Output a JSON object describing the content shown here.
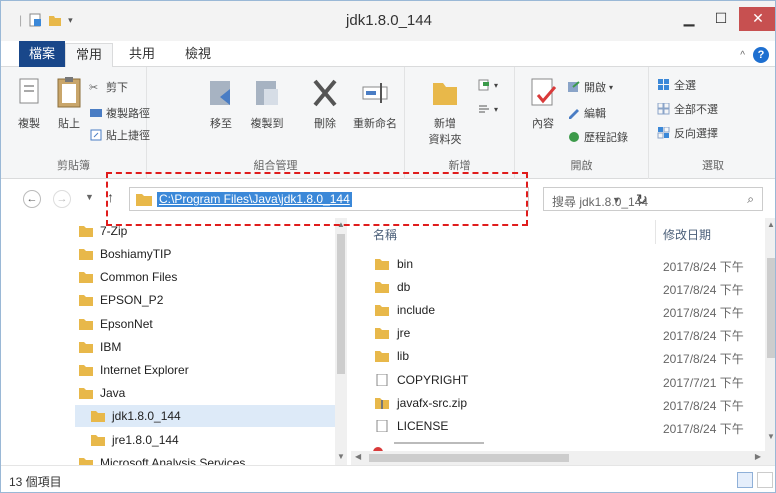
{
  "window": {
    "title": "jdk1.8.0_144"
  },
  "tabs": {
    "file": "檔案",
    "home": "常用",
    "share": "共用",
    "view": "檢視"
  },
  "ribbon": {
    "clipboard": {
      "label": "剪貼簿",
      "copy": "複製",
      "paste": "貼上",
      "cut": "剪下",
      "copy_path": "複製路徑",
      "paste_shortcut": "貼上捷徑"
    },
    "organize": {
      "label": "組合管理",
      "move_to": "移至",
      "copy_to": "複製到",
      "delete": "刪除",
      "rename": "重新命名"
    },
    "new": {
      "label": "新增",
      "new_folder_line1": "新增",
      "new_folder_line2": "資料夾"
    },
    "open": {
      "label": "開啟",
      "properties": "內容",
      "open": "開啟",
      "edit": "編輯",
      "history": "歷程記錄"
    },
    "select": {
      "label": "選取",
      "select_all": "全選",
      "select_none": "全部不選",
      "invert": "反向選擇"
    }
  },
  "address": {
    "path": "C:\\Program Files\\Java\\jdk1.8.0_144",
    "search_placeholder": "搜尋 jdk1.8.0_144"
  },
  "tree": [
    {
      "label": "7-Zip"
    },
    {
      "label": "BoshiamyTIP"
    },
    {
      "label": "Common Files"
    },
    {
      "label": "EPSON_P2"
    },
    {
      "label": "EpsonNet"
    },
    {
      "label": "IBM"
    },
    {
      "label": "Internet Explorer"
    },
    {
      "label": "Java"
    },
    {
      "label": "jdk1.8.0_144"
    },
    {
      "label": "jre1.8.0_144"
    },
    {
      "label": "Microsoft Analysis Services"
    }
  ],
  "list": {
    "col_name": "名稱",
    "col_date": "修改日期",
    "rows": [
      {
        "name": "bin",
        "date": "2017/8/24 下午",
        "type": "folder"
      },
      {
        "name": "db",
        "date": "2017/8/24 下午",
        "type": "folder"
      },
      {
        "name": "include",
        "date": "2017/8/24 下午",
        "type": "folder"
      },
      {
        "name": "jre",
        "date": "2017/8/24 下午",
        "type": "folder"
      },
      {
        "name": "lib",
        "date": "2017/8/24 下午",
        "type": "folder"
      },
      {
        "name": "COPYRIGHT",
        "date": "2017/7/21 下午",
        "type": "file"
      },
      {
        "name": "javafx-src.zip",
        "date": "2017/8/24 下午",
        "type": "zip"
      },
      {
        "name": "LICENSE",
        "date": "2017/8/24 下午",
        "type": "file"
      }
    ]
  },
  "status": {
    "count": "13 個項目"
  },
  "colors": {
    "accent": "#19478a",
    "selection": "#3b88d8",
    "highlight_box": "#e01c1c",
    "folder": "#e8b84a"
  }
}
